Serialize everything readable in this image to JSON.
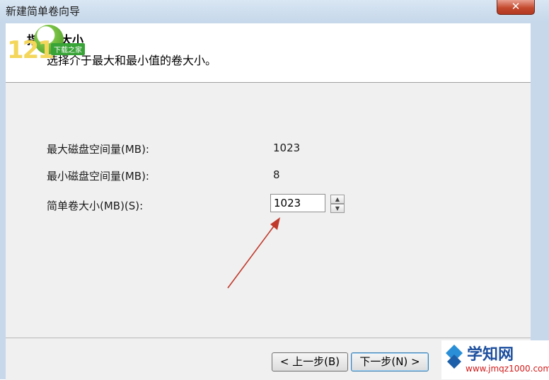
{
  "window": {
    "title": "新建简单卷向导",
    "close_glyph": "✕"
  },
  "header": {
    "title": "指定卷大小",
    "subtitle": "选择介于最大和最小值的卷大小。"
  },
  "fields": {
    "max_label": "最大磁盘空间量(MB):",
    "max_value": "1023",
    "min_label": "最小磁盘空间量(MB):",
    "min_value": "8",
    "size_label": "简单卷大小(MB)(S):",
    "size_value": "1023"
  },
  "buttons": {
    "back": "< 上一步(B)",
    "next": "下一步(N) >"
  },
  "overlay": {
    "logo_number": "121",
    "logo_tag": "下载之家",
    "watermark_name": "学知网",
    "watermark_url": "www.jmqz1000.com",
    "arrow_color": "#c0392b"
  }
}
